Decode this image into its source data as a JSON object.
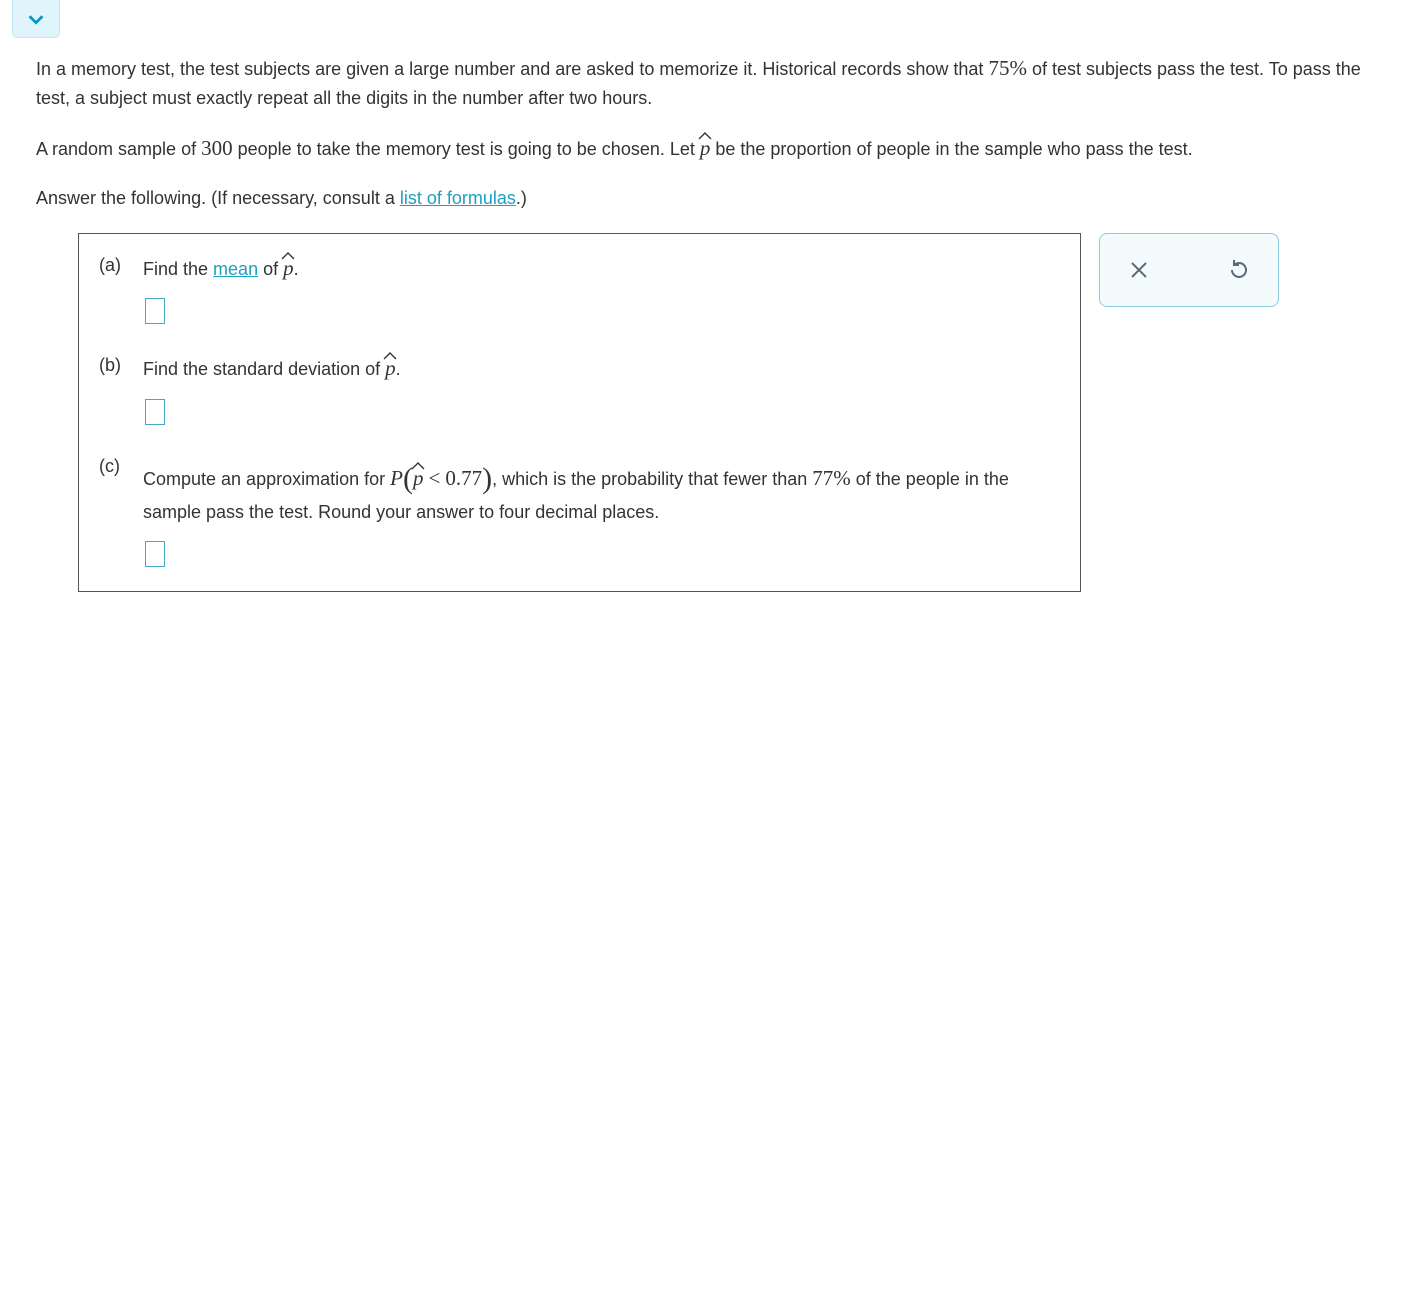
{
  "problem": {
    "intro_p1_a": "In a memory test, the test subjects are given a large number and are asked to memorize it. Historical records show that ",
    "pass_rate": "75%",
    "intro_p1_b": " of test subjects pass the test. To pass the test, a subject must exactly repeat all the digits in the number after two hours.",
    "intro_p2_a": "A random sample of ",
    "sample_size": "300",
    "intro_p2_b": " people to take the memory test is going to be chosen. Let ",
    "intro_p2_c": " be the proportion of people in the sample who pass the test.",
    "answer_prompt_a": "Answer the following. (If necessary, consult a ",
    "formulas_link": "list of formulas",
    "answer_prompt_b": ".)"
  },
  "parts": {
    "a": {
      "label": "(a)",
      "text_a": "Find the ",
      "link": "mean",
      "text_b": " of ",
      "text_c": "."
    },
    "b": {
      "label": "(b)",
      "text_a": "Find the standard deviation of ",
      "text_b": "."
    },
    "c": {
      "label": "(c)",
      "text_a": "Compute an approximation for ",
      "P": "P",
      "lt": "<",
      "val": "0.77",
      "text_b": ", which is the probability that fewer than ",
      "pct": "77%",
      "text_c": " of the people in the sample pass the test. Round your answer to four decimal places."
    }
  },
  "symbols": {
    "p": "p"
  }
}
